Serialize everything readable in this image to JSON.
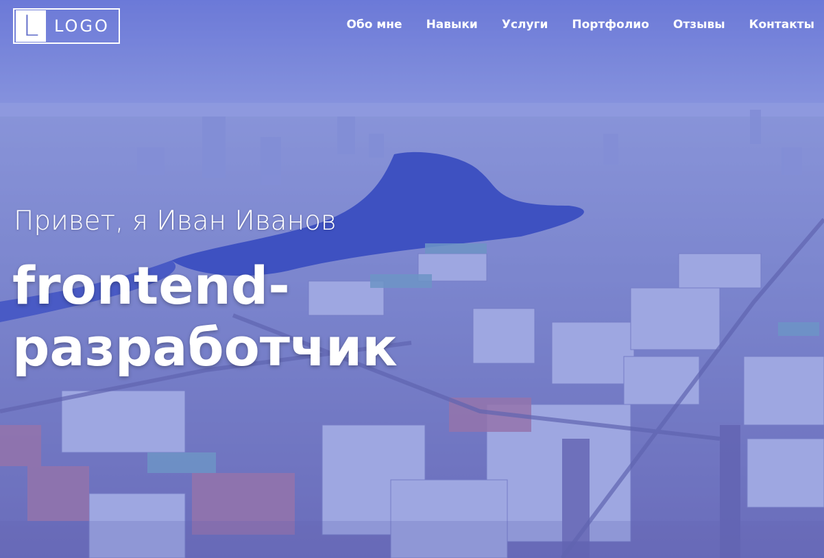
{
  "header": {
    "logo": {
      "mark": "L",
      "text": "LOGO"
    },
    "nav": [
      {
        "label": "Обо мне"
      },
      {
        "label": "Навыки"
      },
      {
        "label": "Услуги"
      },
      {
        "label": "Портфолио"
      },
      {
        "label": "Отзывы"
      },
      {
        "label": "Контакты"
      }
    ]
  },
  "hero": {
    "greeting": "Привет, я Иван Иванов",
    "role_line1": "frontend-",
    "role_line2": "разработчик"
  },
  "colors": {
    "overlay": "#4858c8",
    "sky": "#8e9be0",
    "river": "#3348b8",
    "text": "#ffffff"
  }
}
